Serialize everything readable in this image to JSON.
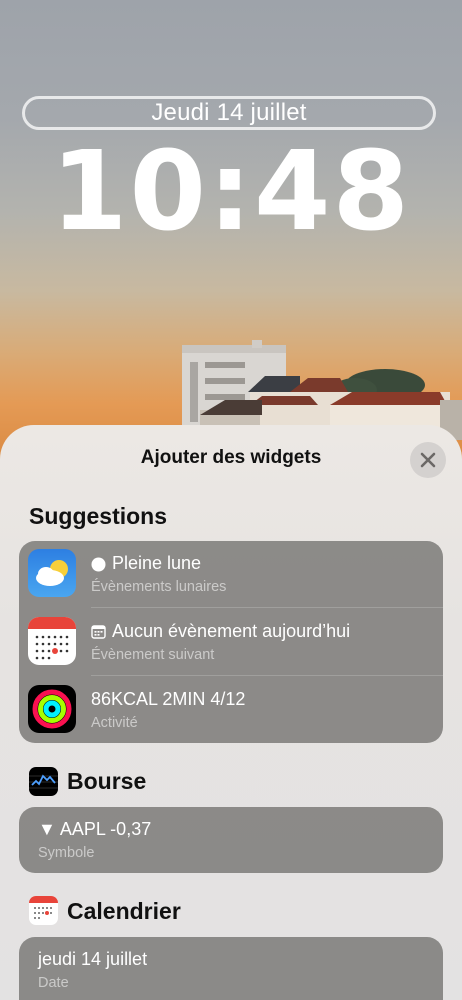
{
  "lock_screen": {
    "date": "Jeudi 14 juillet",
    "time": "10:48"
  },
  "sheet": {
    "title": "Ajouter des widgets",
    "close_icon": "close-icon",
    "suggestions": {
      "heading": "Suggestions",
      "items": [
        {
          "icon": "weather-app-icon",
          "glyph": "circle-icon",
          "title": "Pleine lune",
          "subtitle": "Évènements lunaires"
        },
        {
          "icon": "calendar-app-icon",
          "glyph": "calendar-glyph-icon",
          "title": "Aucun évènement aujourd’hui",
          "subtitle": "Évènement suivant"
        },
        {
          "icon": "activity-app-icon",
          "title": "86KCAL 2MIN 4/12",
          "subtitle": "Activité"
        }
      ]
    },
    "stocks": {
      "heading": "Bourse",
      "icon": "stocks-app-icon",
      "widget": {
        "title": "▼ AAPL -0,37",
        "subtitle": "Symbole"
      }
    },
    "calendar": {
      "heading": "Calendrier",
      "icon": "calendar-app-icon",
      "widget": {
        "title": "jeudi 14 juillet",
        "subtitle": "Date"
      }
    }
  },
  "colors": {
    "sheet_bg": "#e6e3e1",
    "card_bg": "#7a7876",
    "calendar_red": "#e8443a",
    "weather_blue": "#2f8ce8"
  }
}
